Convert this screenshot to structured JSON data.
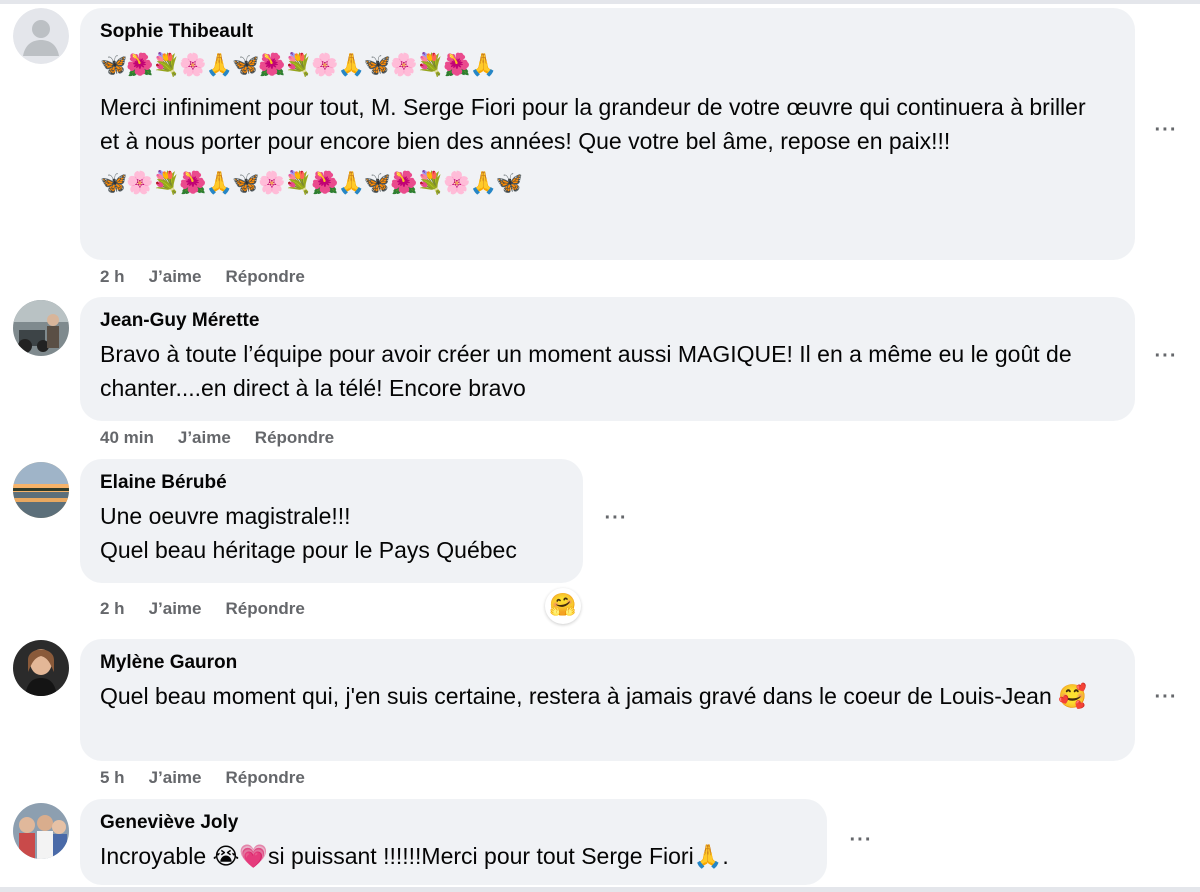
{
  "comments": [
    {
      "author": "Sophie Thibeault",
      "emoji_top": "🦋🌺💐🌸🙏🦋🌺💐🌸🙏🦋🌸💐🌺🙏",
      "text": "Merci infiniment pour tout, M. Serge Fiori pour la grandeur de votre œuvre qui continuera à briller et à nous porter pour encore bien des années! Que votre bel âme, repose en paix!!!",
      "emoji_bottom": "🦋🌸💐🌺🙏🦋🌸💐🌺🙏🦋🌺💐🌸🙏🦋",
      "time": "2 h",
      "like": "J’aime",
      "reply": "Répondre",
      "more": "···"
    },
    {
      "author": "Jean-Guy Mérette",
      "text": "Bravo à toute l’équipe pour avoir créer un moment aussi MAGIQUE! Il en a même eu le goût de chanter....en direct à la télé! Encore bravo",
      "time": "40 min",
      "like": "J’aime",
      "reply": "Répondre",
      "more": "···"
    },
    {
      "author": "Elaine Bérubé",
      "line1": "Une oeuvre magistrale!!!",
      "line2": "Quel beau héritage pour le Pays Québec",
      "time": "2 h",
      "like": "J’aime",
      "reply": "Répondre",
      "more": "···",
      "reaction": "🤗"
    },
    {
      "author": "Mylène Gauron",
      "text": "Quel beau moment qui, j'en suis certaine, restera à jamais gravé dans le coeur de Louis-Jean",
      "emoji": "🥰",
      "time": "5 h",
      "like": "J’aime",
      "reply": "Répondre",
      "more": "···"
    },
    {
      "author": "Geneviève Joly",
      "text_a": "Incroyable ",
      "emoji_a": "😭💗",
      "text_b": "si puissant !!!!!!Merci pour tout Serge Fiori",
      "emoji_b": "🙏",
      "text_c": ".",
      "more": "···"
    }
  ],
  "colors": {
    "bubble": "#f0f2f5",
    "secondary_text": "#65676b",
    "primary_text": "#050505"
  }
}
